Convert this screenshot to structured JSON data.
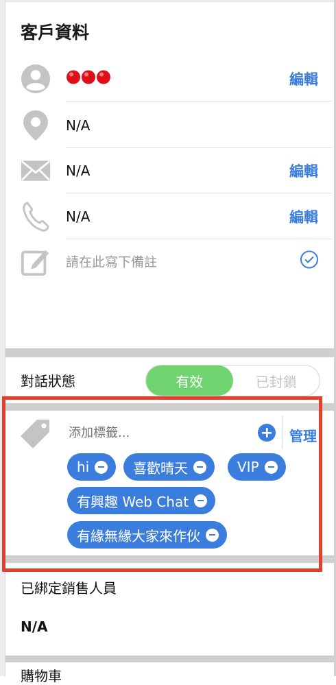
{
  "panel": {
    "title": "客戶資料"
  },
  "contact": {
    "name_icons": [
      "red-dot",
      "red-dot",
      "red-dot"
    ],
    "location": "N/A",
    "email": "N/A",
    "phone": "N/A",
    "note_placeholder": "請在此寫下備註",
    "edit_label": "編輯"
  },
  "status": {
    "label": "對話狀態",
    "options": [
      "有效",
      "已封鎖"
    ],
    "selected": "有效",
    "active_color": "#6fd46f"
  },
  "tags": {
    "placeholder": "添加標籤...",
    "manage_label": "管理",
    "items": [
      "hi",
      "喜歡晴天",
      "VIP",
      "有興趣 Web Chat",
      "有緣無緣大家來作伙"
    ],
    "chip_color": "#3b7ddd"
  },
  "sales": {
    "label": "已綁定銷售人員",
    "value": "N/A"
  },
  "next_section": {
    "label": "購物車"
  },
  "colors": {
    "accent": "#3b7ddd",
    "highlight": "#e5402b"
  }
}
